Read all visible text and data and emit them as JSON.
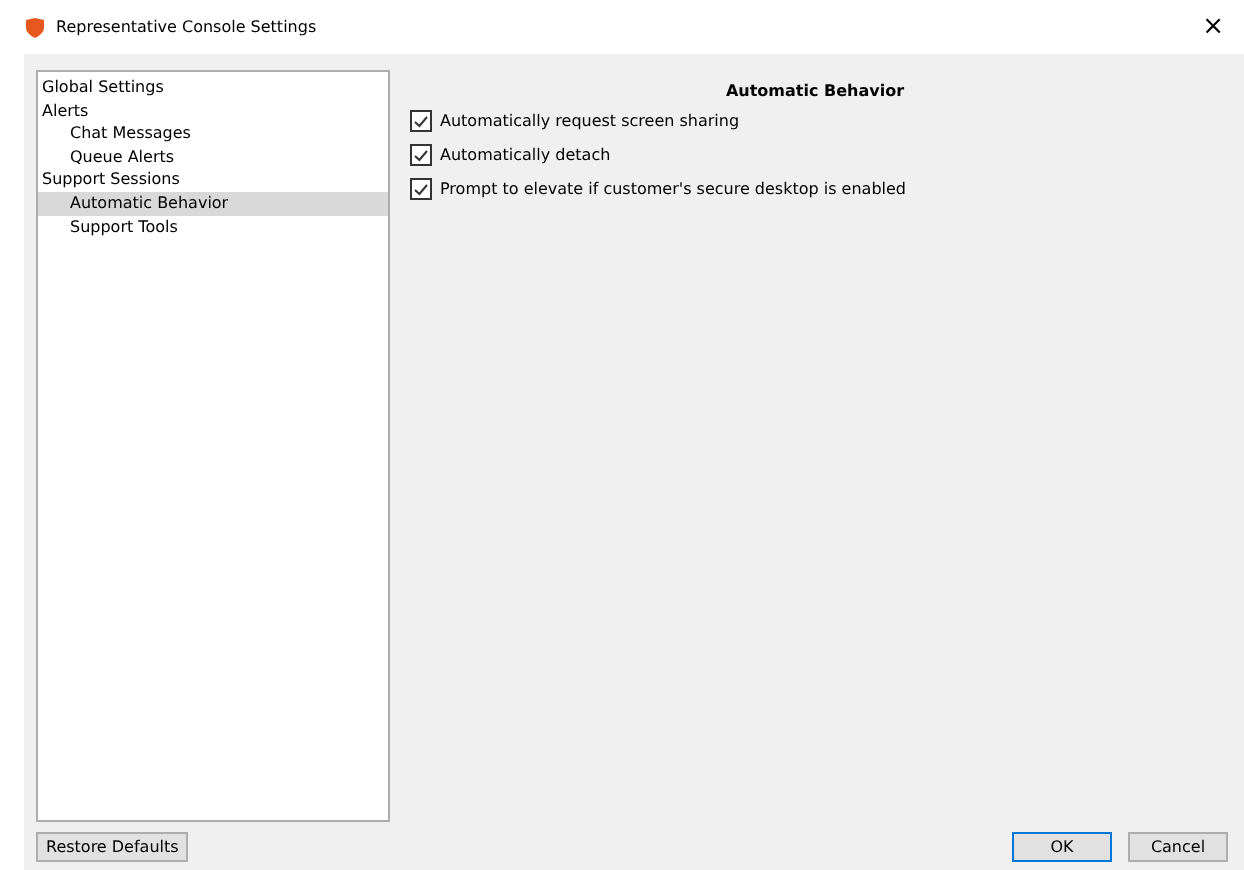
{
  "window": {
    "title": "Representative Console Settings",
    "close": "×"
  },
  "tree": [
    {
      "label": "Global Settings",
      "selected": false
    },
    {
      "label": "Alerts",
      "selected": false,
      "children": [
        {
          "label": "Chat Messages",
          "selected": false
        },
        {
          "label": "Queue Alerts",
          "selected": false
        }
      ]
    },
    {
      "label": "Support Sessions",
      "selected": false,
      "children": [
        {
          "label": "Automatic Behavior",
          "selected": true
        },
        {
          "label": "Support Tools",
          "selected": false
        }
      ]
    }
  ],
  "section": {
    "title": "Automatic Behavior",
    "options": [
      {
        "label": "Automatically request screen sharing",
        "checked": true
      },
      {
        "label": "Automatically detach",
        "checked": true
      },
      {
        "label": "Prompt to elevate if customer's secure desktop is enabled",
        "checked": true
      }
    ]
  },
  "buttons": {
    "restore": "Restore Defaults",
    "ok": "OK",
    "cancel": "Cancel"
  }
}
